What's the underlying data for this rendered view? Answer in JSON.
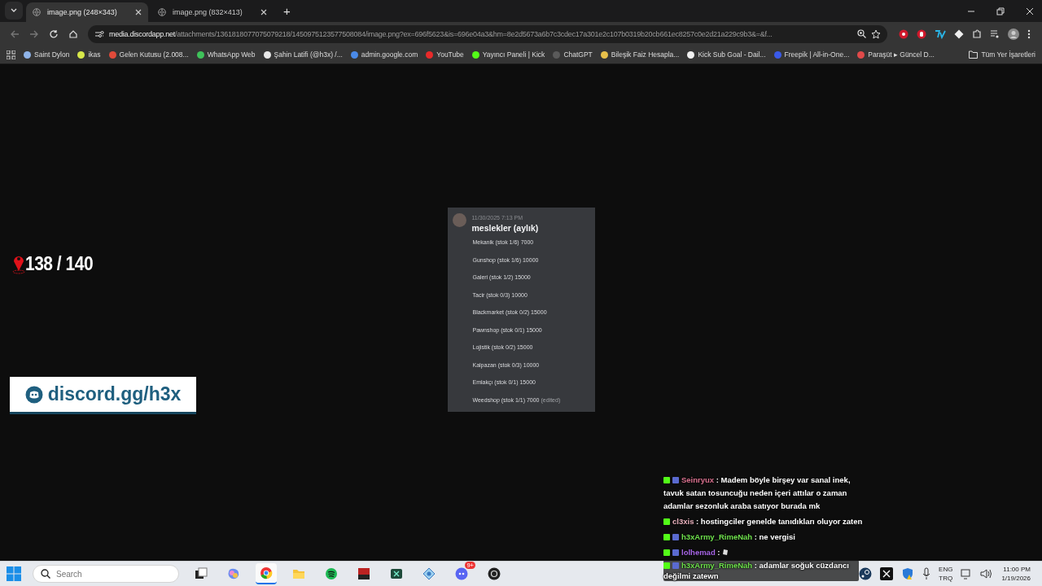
{
  "browser": {
    "tabs": [
      {
        "title": "image.png (248×343)",
        "selected": true
      },
      {
        "title": "image.png (832×413)",
        "selected": false
      }
    ],
    "new_tab": "+",
    "address": {
      "domain": "media.discordapp.net",
      "path": "/attachments/1361818077075079218/1450975123577508084/image.png?ex=696f5623&is=696e04a3&hm=8e2d5673a6b7c3cdec17a301e2c107b0319b20cb661ec8257c0e2d21a229c9b3&=&f..."
    },
    "bookmarks": [
      {
        "label": "Saint Dylon",
        "color": "#8fb3e8"
      },
      {
        "label": "ikas",
        "color": "#d8e84a"
      },
      {
        "label": "Gelen Kutusu (2.008...",
        "color": "#e04a3a"
      },
      {
        "label": "WhatsApp Web",
        "color": "#3fc25a"
      },
      {
        "label": "Şahin Latifi (@h3x) /...",
        "color": "#e8e8e8"
      },
      {
        "label": "admin.google.com",
        "color": "#4a8ae8"
      },
      {
        "label": "YouTube",
        "color": "#e82a2a"
      },
      {
        "label": "Yayıncı Paneli | Kick",
        "color": "#53fc18"
      },
      {
        "label": "ChatGPT",
        "color": "#5a5a5a"
      },
      {
        "label": "Bileşik Faiz Hesapla...",
        "color": "#e8c04a"
      },
      {
        "label": "Kick Sub Goal - Dail...",
        "color": "#f0f0f0"
      },
      {
        "label": "Freepik | All-in-One...",
        "color": "#3a5ae8"
      },
      {
        "label": "Paraşüt ▸ Güncel D...",
        "color": "#e04a4a"
      }
    ],
    "all_bookmarks": "Tüm Yer İşaretleri"
  },
  "viewer": {
    "message": {
      "timestamp": "11/30/2025 7:13 PM",
      "title": "meslekler (aylık)",
      "lines": [
        "Mekanik (stok 1/6) 7000",
        "Gunshop (stok 1/6) 10000",
        "Galeri (stok 1/2) 15000",
        "Tacir (stok 0/3) 10000",
        "Blackmarket (stok 0/2) 15000",
        "Pawnshop (stok 0/1) 15000",
        "Lojistik (stok 0/2) 15000",
        "Kalpazan (stok 0/3) 10000",
        "Emlakçı (stok 0/1) 15000",
        "Weedshop (stok 1/1) 7000"
      ],
      "edited": "(edited)"
    }
  },
  "overlay": {
    "counter": "138 / 140",
    "discord_link": "discord.gg/h3x",
    "chat": [
      {
        "user": "Seinryux",
        "color": "#d8708e",
        "subscriber": true,
        "kind": "text",
        "text": ": Madem böyle birşey var sanal inek, tavuk satan tosuncuğu neden içeri attılar o zaman adamlar sezonluk araba satıyor burada mk"
      },
      {
        "user": "cl3xis",
        "color": "#e8b0bc",
        "subscriber": false,
        "kind": "text",
        "text": ": hostingciler genelde tanıdıkları oluyor zaten"
      },
      {
        "user": "h3xArmy_RimeNah",
        "color": "#6ee04c",
        "subscriber": true,
        "kind": "text",
        "text": ": ne vergisi"
      },
      {
        "user": "lolhemad",
        "color": "#a766e6",
        "subscriber": true,
        "kind": "emote",
        "text": ":"
      },
      {
        "user": "h3xArmy_RimeNah",
        "color": "#6ee04c",
        "subscriber": true,
        "kind": "text",
        "text": ": adamlar soğuk cüzdancı değilmi zatewn"
      }
    ]
  },
  "taskbar": {
    "search": {
      "placeholder": "Search"
    },
    "apps": [
      {
        "kind": "taskview",
        "selected": false
      },
      {
        "kind": "copilot",
        "selected": false
      },
      {
        "kind": "chrome",
        "selected": true
      },
      {
        "kind": "explorer",
        "selected": false
      },
      {
        "kind": "spotify",
        "selected": false
      },
      {
        "kind": "voicemeeter",
        "selected": false
      },
      {
        "kind": "terminal",
        "selected": false
      },
      {
        "kind": "network",
        "selected": false
      },
      {
        "kind": "discord",
        "selected": false,
        "badge": "9+"
      },
      {
        "kind": "obs",
        "selected": false
      }
    ],
    "language": "ENG",
    "layout": "TRQ",
    "time": "11:00 PM",
    "date": "1/19/2026"
  }
}
